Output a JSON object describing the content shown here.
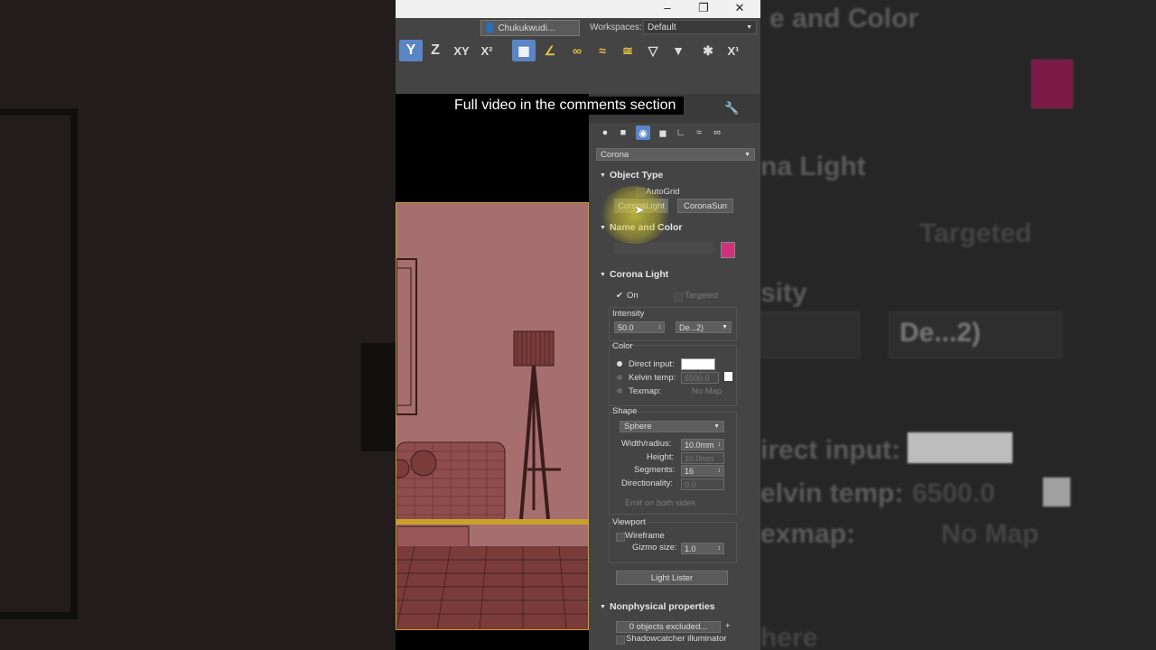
{
  "caption": "Full video in the comments section",
  "menubar": {
    "user": "Chukukwudi...",
    "workspaces_label": "Workspaces:",
    "workspaces_value": "Default"
  },
  "toolbar": {
    "axis_y": "Y",
    "axis_z": "Z",
    "axis_xy": "XY",
    "axis_x2": "X²"
  },
  "panel": {
    "category_dropdown": "Corona",
    "object_type": {
      "title": "Object Type",
      "autogrid": "AutoGrid",
      "btn_coronalight": "CoronaLight",
      "btn_coronasun": "CoronaSun"
    },
    "name_and_color": {
      "title": "Name and Color",
      "swatch_color": "#d0307a"
    },
    "corona_light": {
      "title": "Corona Light",
      "on": "On",
      "targeted": "Targeted",
      "intensity_label": "Intensity",
      "intensity_value": "50.0",
      "intensity_unit": "De...2)",
      "color_label": "Color",
      "direct_input": "Direct input:",
      "kelvin_temp": "Kelvin temp:",
      "kelvin_value": "6500.0",
      "texmap": "Texmap:",
      "no_map": "No Map",
      "shape_label": "Shape",
      "shape_value": "Sphere",
      "width_radius_label": "Width/radius:",
      "width_radius_value": "10.0mm",
      "height_label": "Height:",
      "height_value": "10.0mm",
      "segments_label": "Segments:",
      "segments_value": "16",
      "directionality_label": "Directionality:",
      "directionality_value": "0.0",
      "emit_both": "Emit on both sides",
      "viewport_label": "Viewport",
      "wireframe": "Wireframe",
      "gizmo_label": "Gizmo size:",
      "gizmo_value": "1.0",
      "light_lister": "Light Lister"
    },
    "nonphysical": {
      "title": "Nonphysical properties",
      "excluded": "0 objects excluded...",
      "shadowcatcher": "Shadowcatcher illuminator"
    }
  },
  "ghost": {
    "name_color": "e and Color",
    "na_light": "na Light",
    "targeted": "Targeted",
    "sity": "sity",
    "de2": "De...2)",
    "direct_input": "irect input:",
    "kelvin": "elvin temp:",
    "kelvin_val": "6500.0",
    "texmap": "exmap:",
    "nomap": "No Map",
    "here": "here"
  }
}
